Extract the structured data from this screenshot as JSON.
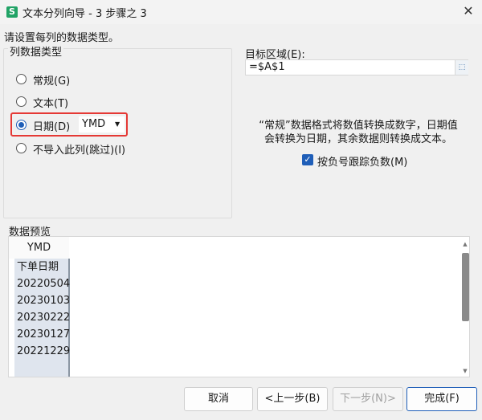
{
  "window": {
    "title": "文本分列向导 - 3 步骤之 3",
    "app_icon_text": "S",
    "close_glyph": "✕"
  },
  "intro": "请设置每列的数据类型。",
  "column_type": {
    "group_title": "列数据类型",
    "options": [
      {
        "label": "常规(G)",
        "checked": false
      },
      {
        "label": "文本(T)",
        "checked": false
      },
      {
        "label": "日期(D)",
        "checked": true
      },
      {
        "label": "不导入此列(跳过)(I)",
        "checked": false
      }
    ],
    "date_format": "YMD"
  },
  "target": {
    "label": "目标区域(E):",
    "value": "=$A$1"
  },
  "description_lines": [
    "“常规”数据格式将数值转换成数字，日期值",
    "会转换为日期，其余数据则转换成文本。"
  ],
  "negative_checkbox": {
    "label": "按负号跟踪负数(M)",
    "checked": true
  },
  "preview": {
    "title": "数据预览",
    "column_header": "YMD",
    "rows": [
      "下单日期",
      "20220504",
      "20230103",
      "20230222",
      "20230127",
      "20221229"
    ]
  },
  "buttons": {
    "cancel": "取消",
    "back": "<上一步(B)",
    "next": "下一步(N)>",
    "finish": "完成(F)"
  },
  "colors": {
    "accent": "#1f5eb8",
    "highlight": "#e53935",
    "app_icon": "#21a366"
  }
}
